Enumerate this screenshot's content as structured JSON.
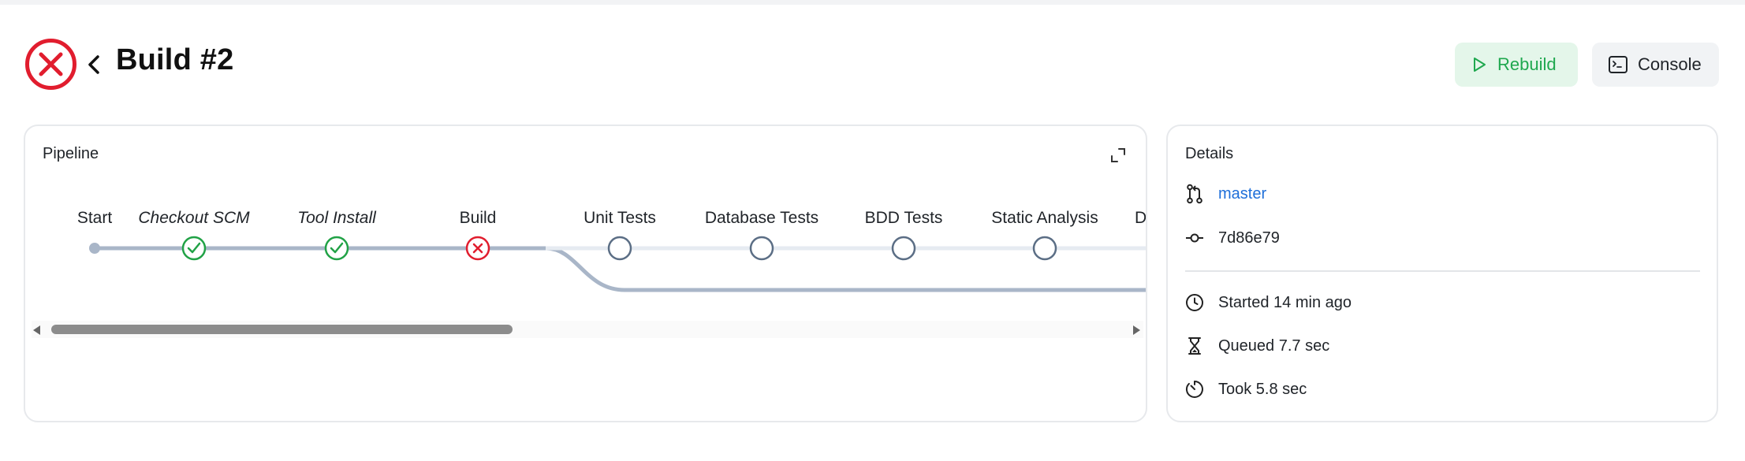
{
  "header": {
    "title": "Build #2",
    "rebuild_label": "Rebuild",
    "console_label": "Console"
  },
  "pipeline": {
    "title": "Pipeline",
    "stages": [
      {
        "label": "Start",
        "status": "start"
      },
      {
        "label": "Checkout SCM",
        "status": "success"
      },
      {
        "label": "Tool Install",
        "status": "success"
      },
      {
        "label": "Build",
        "status": "failed"
      },
      {
        "label": "Unit Tests",
        "status": "not-run"
      },
      {
        "label": "Database Tests",
        "status": "not-run"
      },
      {
        "label": "BDD Tests",
        "status": "not-run"
      },
      {
        "label": "Static Analysis",
        "status": "not-run"
      },
      {
        "label": "De",
        "status": "not-run"
      }
    ]
  },
  "details": {
    "title": "Details",
    "branch": "master",
    "commit": "7d86e79",
    "started": "Started 14 min ago",
    "queued": "Queued 7.7 sec",
    "took": "Took 5.8 sec"
  },
  "colors": {
    "success": "#21a246",
    "failed": "#e11d2e",
    "not_run": "#5b6e85",
    "line": "#a9b6c8",
    "link": "#1e6fd9"
  }
}
